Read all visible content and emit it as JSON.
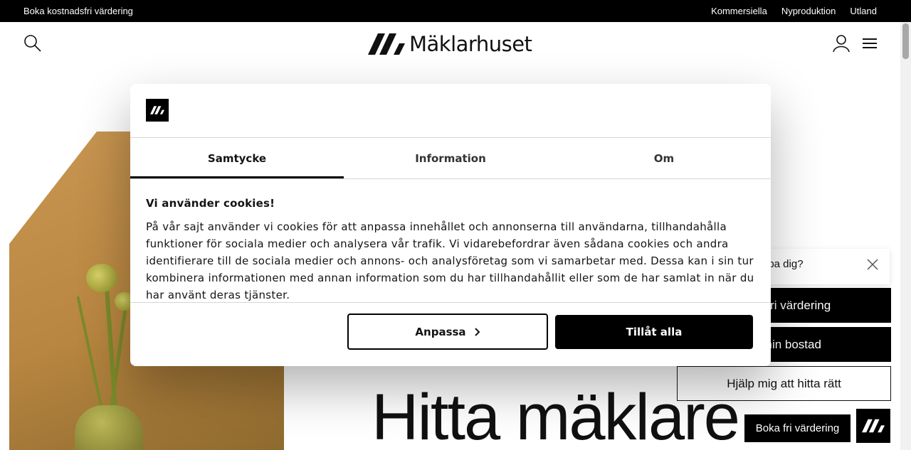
{
  "topbar": {
    "left_link": "Boka kostnadsfri värdering",
    "right_links": [
      "Kommersiella",
      "Nyproduktion",
      "Utland"
    ]
  },
  "header": {
    "logo_text": "Mäklarhuset",
    "icons": [
      "search-icon",
      "user-icon",
      "hamburger-menu-icon"
    ]
  },
  "hero": {
    "title": "Hitta mäklare"
  },
  "help_widget": {
    "question": "lpa dig?",
    "buttons": [
      "tnadsfri värdering",
      "lja min bostad",
      "Hjälp mig att hitta rätt"
    ],
    "fab_label": "Boka fri värdering"
  },
  "cookie_modal": {
    "tabs": [
      "Samtycke",
      "Information",
      "Om"
    ],
    "active_tab": "Samtycke",
    "heading": "Vi använder cookies!",
    "body": "På vår sajt använder vi cookies för att anpassa innehållet och annonserna till användarna, tillhandahålla funktioner för sociala medier och analysera vår trafik. Vi vidarebefordrar även sådana cookies och andra identifierare till de sociala medier och annons- och analysföretag som vi samarbetar med. Dessa kan i sin tur kombinera informationen med annan information som du har tillhandahållit eller som de har samlat in när du har använt deras tjänster.",
    "customize_label": "Anpassa",
    "allow_label": "Tillåt alla"
  },
  "colors": {
    "brand": "#000000",
    "accent_hero": "#c99752"
  }
}
